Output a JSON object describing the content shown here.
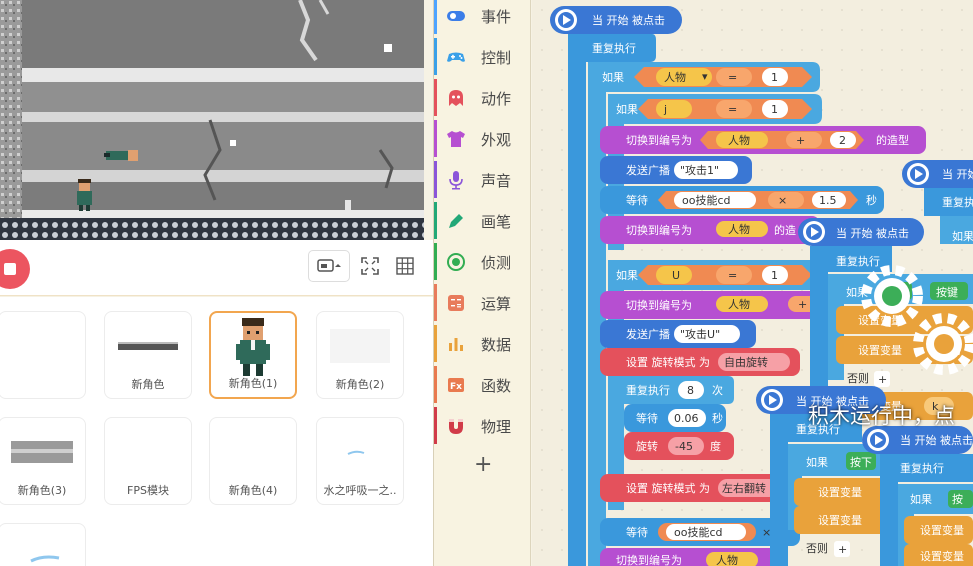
{
  "stage_toolbar": {
    "stop_icon": "stop-icon",
    "screen_mode_icon": "screen-mode-icon",
    "fullscreen_icon": "fullscreen-icon",
    "grid_icon": "grid-icon"
  },
  "sprites": [
    {
      "label": ""
    },
    {
      "label": "新角色"
    },
    {
      "label": "新角色(1)"
    },
    {
      "label": "新角色(2)"
    },
    {
      "label": "新角色(3)"
    },
    {
      "label": "FPS模块"
    },
    {
      "label": "新角色(4)"
    },
    {
      "label": "水之呼吸一之.."
    },
    {
      "label": ""
    }
  ],
  "categories": [
    {
      "label": "事件",
      "color": "#4da3ff",
      "icon": "toggle-icon"
    },
    {
      "label": "控制",
      "color": "#3aa0e8",
      "icon": "gamepad-icon"
    },
    {
      "label": "动作",
      "color": "#e4515c",
      "icon": "ghost-icon"
    },
    {
      "label": "外观",
      "color": "#b64fd1",
      "icon": "shirt-icon"
    },
    {
      "label": "声音",
      "color": "#8b55d9",
      "icon": "microphone-icon"
    },
    {
      "label": "画笔",
      "color": "#22a877",
      "icon": "pen-icon"
    },
    {
      "label": "侦测",
      "color": "#32ad52",
      "icon": "sensor-icon"
    },
    {
      "label": "运算",
      "color": "#e87b5c",
      "icon": "calculator-icon"
    },
    {
      "label": "数据",
      "color": "#e9a23b",
      "icon": "bar-chart-icon"
    },
    {
      "label": "函数",
      "color": "#e97a4f",
      "icon": "function-icon"
    },
    {
      "label": "物理",
      "color": "#d13b49",
      "icon": "magnet-icon"
    }
  ],
  "add_category_label": "+",
  "code": {
    "hat_when_clicked": "当 开始 被点击",
    "forever": "重复执行",
    "if": "如果",
    "else": "否则",
    "eq": "=",
    "plus": "+",
    "times": "×",
    "var_character": "人物",
    "var_j": "j",
    "var_u": "U",
    "var_cd": "oo技能cd",
    "num_1": "1",
    "num_2": "2",
    "num_15": "1.5",
    "num_8": "8",
    "num_006": "0.06",
    "num_neg45": "-45",
    "switch_costume": "切换到编号为",
    "costume_suffix": "的造型",
    "costume_suffix_short": "的造",
    "broadcast": "发送广播",
    "msg_attack1": "\"攻击1\"",
    "msg_attacku": "\"攻击U\"",
    "wait": "等待",
    "seconds": "秒",
    "set_rotation": "设置 旋转模式 为",
    "rotation_free": "自由旋转",
    "rotation_lr": "左右翻转",
    "repeat": "重复执行",
    "times_suffix": "次",
    "rotate": "旋转",
    "degree": "度",
    "press": "按下",
    "press_short": "按",
    "key": "按键",
    "set_var": "设置变量",
    "var_k": "k",
    "else_plus": "+",
    "of": "的",
    "hat_when_clicked_short": "当 开始"
  },
  "running_overlay": "积木运行中，点"
}
